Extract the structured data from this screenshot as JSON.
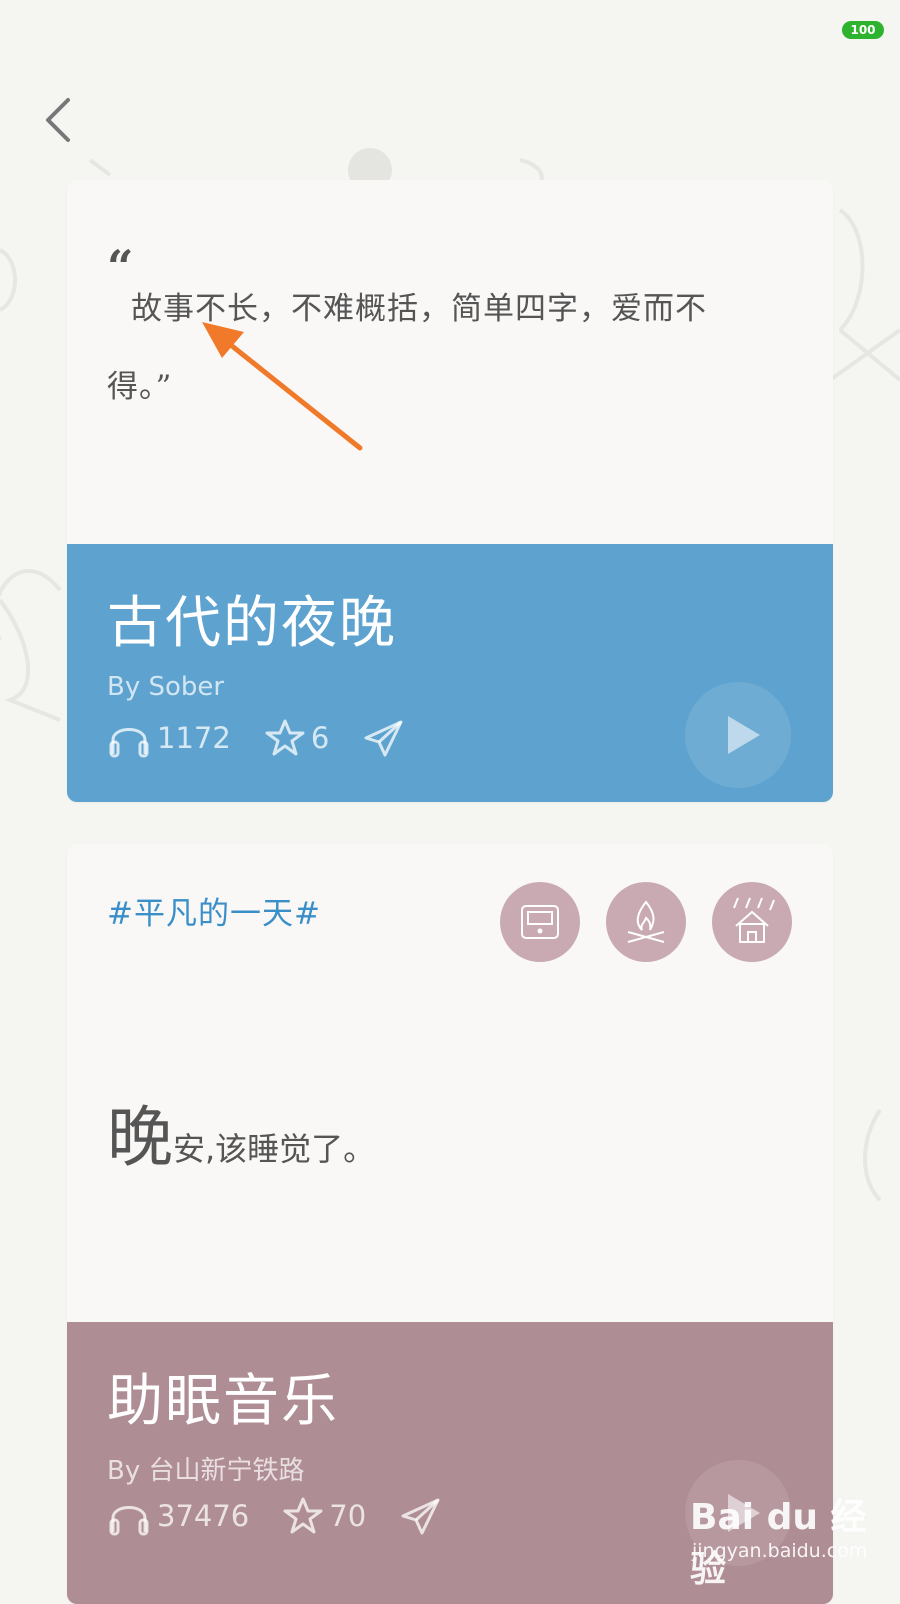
{
  "status_bar": {
    "battery": "100",
    "battery_color": "#2db32d"
  },
  "nav": {
    "back_icon": "chevron-left-icon"
  },
  "card1": {
    "quote_open": "“",
    "quote": "故事不长，不难概括，简单四字，爱而不得。",
    "quote_close": "”",
    "title": "古代的夜晚",
    "author": "By Sober",
    "listens": "1172",
    "stars": "6",
    "color": "#5ea3cf"
  },
  "card2": {
    "hashtag": "#平凡的一天#",
    "icons": [
      "radio-icon",
      "campfire-icon",
      "rain-house-icon"
    ],
    "greeting_big": "晚",
    "greeting_rest": "安,该睡觉了。",
    "title": "助眠音乐",
    "author": "By 台山新宁铁路",
    "listens": "37476",
    "stars": "70",
    "color": "#af8d95"
  },
  "annotation": {
    "arrow_color": "#f07a2a"
  },
  "watermark": {
    "logo": "Bai du 经验",
    "site": "jingyan.baidu.com"
  }
}
